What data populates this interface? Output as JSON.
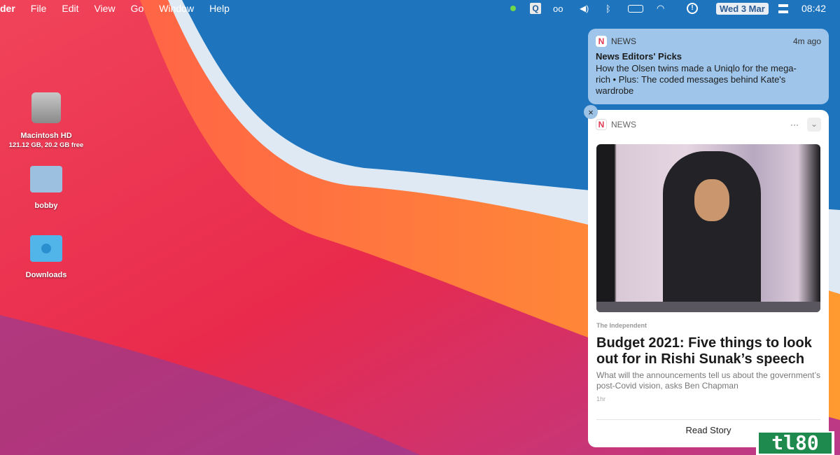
{
  "menubar": {
    "app": "der",
    "items": [
      "File",
      "Edit",
      "View",
      "Go",
      "Window",
      "Help"
    ],
    "date": "Wed 3 Mar",
    "time": "08:42",
    "status_icons": [
      "green-dot-icon",
      "quicktime-icon",
      "glasses-icon",
      "volume-icon",
      "bluetooth-icon",
      "battery-charging-icon",
      "wifi-icon",
      "info-icon"
    ]
  },
  "desktop": {
    "icons": [
      {
        "name": "Macintosh HD",
        "sub": "121.12 GB, 20.2 GB free"
      },
      {
        "name": "bobby"
      },
      {
        "name": "Downloads"
      }
    ]
  },
  "notification1": {
    "app": "NEWS",
    "time": "4m ago",
    "title": "News Editors' Picks",
    "body": "How the Olsen twins made a Uniqlo for the mega-rich • Plus: The coded messages behind Kate's wardrobe"
  },
  "notification2": {
    "app": "NEWS",
    "source": "The Independent",
    "headline": "Budget 2021: Five things to look out for in Rishi Sunak’s speech",
    "summary": "What will the announcements tell us about the government’s post-Covid vision, asks Ben Chapman",
    "age": "1hr",
    "action": "Read Story",
    "more": "···",
    "close": "×"
  },
  "watermark": "tl80"
}
